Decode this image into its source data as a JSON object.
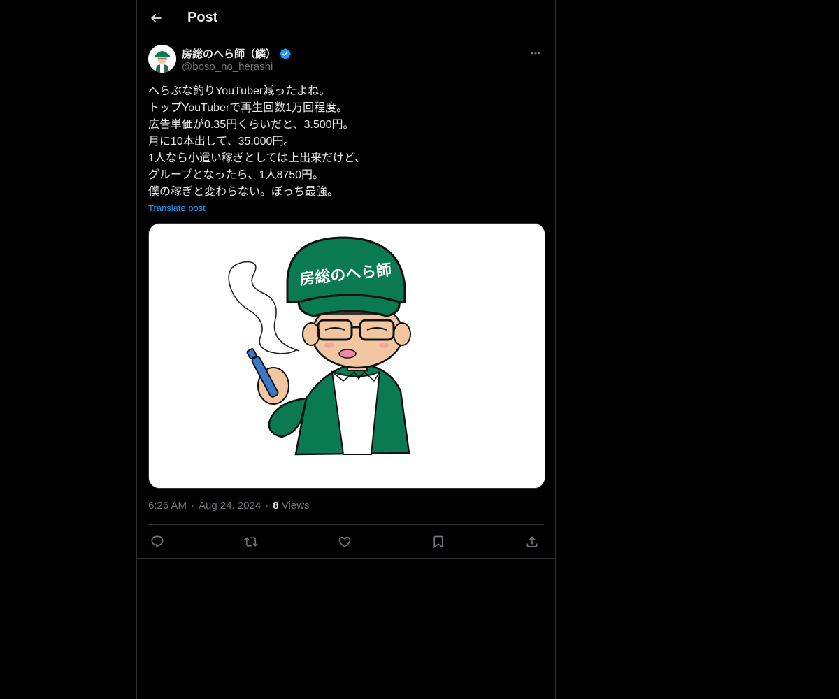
{
  "header": {
    "title": "Post"
  },
  "author": {
    "display_name": "房総のへら師（鱗）",
    "handle": "@boso_no_herashi",
    "verified": true
  },
  "post": {
    "lines": [
      "へらぶな釣りYouTuber減ったよね。",
      "トップYouTuberで再生回数1万回程度。",
      "広告単価が0.35円くらいだと、3.500円。",
      "月に10本出して、35.000円。",
      "1人なら小遣い稼ぎとしては上出来だけど、",
      "グループとなったら、1人8750円。",
      "僕の稼ぎと変わらない。ぼっち最強。"
    ],
    "translate_label": "Translate post",
    "image_text": "房総のへら師"
  },
  "meta": {
    "time": "6:26 AM",
    "separator": "·",
    "date": "Aug 24, 2024",
    "views_count": "8",
    "views_label": "Views"
  },
  "actions": {
    "icons": [
      "reply-icon",
      "repost-icon",
      "like-icon",
      "bookmark-icon",
      "share-icon"
    ]
  },
  "colors": {
    "background": "#000000",
    "text": "#e7e9ea",
    "muted": "#71767b",
    "accent": "#1d9bf0",
    "border": "#2f3336",
    "cap_green": "#0a7a52"
  }
}
